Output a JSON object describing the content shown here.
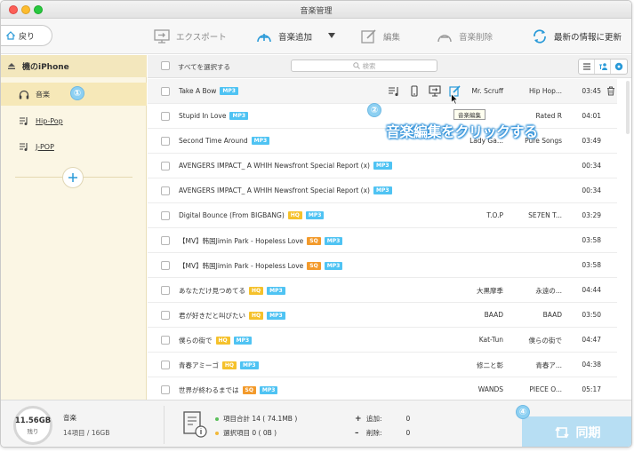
{
  "window": {
    "title": "音楽管理"
  },
  "toolbar": {
    "back_label": "戻り",
    "export_label": "エクスポート",
    "add_label": "音楽追加",
    "edit_label": "編集",
    "delete_label": "音楽削除",
    "refresh_label": "最新の情報に更新"
  },
  "sidebar": {
    "device": "機のiPhone",
    "items": [
      {
        "label": "音楽",
        "icon": "headphones-icon",
        "active": true
      },
      {
        "label": "Hip-Pop",
        "icon": "playlist-icon"
      },
      {
        "label": "J-POP",
        "icon": "playlist-icon"
      }
    ]
  },
  "list": {
    "select_all_label": "すべてを選択する",
    "search_placeholder": "検索",
    "rows": [
      {
        "title": "Take A Bow",
        "badges": [
          "MP3"
        ],
        "artist": "Mr. Scruff",
        "genre": "Hip Hop...",
        "time": "03:45"
      },
      {
        "title": "Stupid In Love",
        "badges": [
          "MP3"
        ],
        "artist": "",
        "genre": "Rated R",
        "time": "04:01"
      },
      {
        "title": "Second Time Around",
        "badges": [
          "MP3"
        ],
        "artist": "Lady Ga...",
        "genre": "Pure Songs",
        "time": "03:49"
      },
      {
        "title": "AVENGERS IMPACT_ A WHIH Newsfront Special Report (x)",
        "badges": [
          "MP3"
        ],
        "artist": "",
        "genre": "",
        "time": "00:34"
      },
      {
        "title": "AVENGERS IMPACT_ A WHIH Newsfront Special Report (x)",
        "badges": [
          "MP3"
        ],
        "artist": "",
        "genre": "",
        "time": "00:34"
      },
      {
        "title": "Digital Bounce (From BIGBANG)",
        "badges": [
          "HQ",
          "MP3"
        ],
        "artist": "T.O.P",
        "genre": "SE7EN T...",
        "time": "03:29"
      },
      {
        "title": "【MV】韩国Jimin Park - Hopeless Love",
        "badges": [
          "SQ",
          "MP3"
        ],
        "artist": "",
        "genre": "",
        "time": "03:58"
      },
      {
        "title": "【MV】韩国Jimin Park - Hopeless Love",
        "badges": [
          "SQ",
          "MP3"
        ],
        "artist": "",
        "genre": "",
        "time": "03:58"
      },
      {
        "title": "あなただけ見つめてる",
        "badges": [
          "HQ",
          "MP3"
        ],
        "artist": "大黒摩季",
        "genre": "永遠の...",
        "time": "04:44"
      },
      {
        "title": "君が好きだと叫びたい",
        "badges": [
          "HQ",
          "MP3"
        ],
        "artist": "BAAD",
        "genre": "BAAD",
        "time": "03:50"
      },
      {
        "title": "僕らの街で",
        "badges": [
          "HQ",
          "MP3"
        ],
        "artist": "Kat-Tun",
        "genre": "僕らの街で",
        "time": "04:47"
      },
      {
        "title": "青春アミーゴ",
        "badges": [
          "HQ",
          "MP3"
        ],
        "artist": "修二と彰",
        "genre": "青春ア...",
        "time": "04:38"
      },
      {
        "title": "世界が終わるまでは",
        "badges": [
          "SQ",
          "MP3"
        ],
        "artist": "WANDS",
        "genre": "PIECE O...",
        "time": "05:17"
      }
    ]
  },
  "tooltip": {
    "text": "音楽編集"
  },
  "annotations": {
    "step1": "①",
    "step2": "②",
    "step2_text": "音楽編集をクリックする",
    "step4": "④"
  },
  "footer": {
    "storage_free": "11.56GB",
    "storage_left_label": "残り",
    "category": "音楽",
    "count": "14項目 / 16GB",
    "total_label": "項目合計 14 ( 74.1MB )",
    "selected_label": "選択項目 0 ( 0B )",
    "add_label": "追加:",
    "add_value": "0",
    "delete_label": "削除:",
    "delete_value": "0",
    "sync_label": "同期"
  },
  "colors": {
    "sidebar_bg": "#fbf6e4",
    "mp3_badge": "#4fc3f3",
    "hq_badge": "#f5c12b",
    "sq_badge": "#f39a2b",
    "accent_blue": "#1e88d6",
    "sync_button": "#b7def3"
  }
}
